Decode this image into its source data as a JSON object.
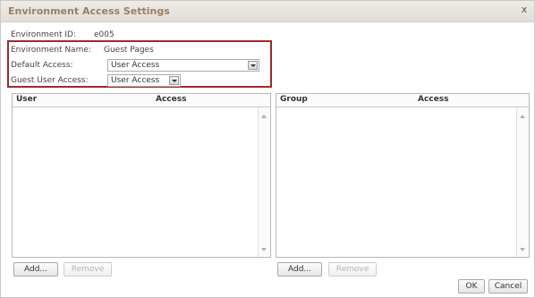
{
  "dialog": {
    "title": "Environment Access Settings",
    "close_label": "x"
  },
  "fields": {
    "environment_id_label": "Environment ID:",
    "environment_id_value": "e005",
    "environment_name_label": "Environment Name:",
    "environment_name_value": "Guest Pages",
    "default_access_label": "Default Access:",
    "default_access_value": "User Access",
    "guest_user_access_label": "Guest User Access:",
    "guest_user_access_value": "User Access"
  },
  "user_panel": {
    "col_user": "User",
    "col_access": "Access",
    "add_label": "Add...",
    "remove_label": "Remove"
  },
  "group_panel": {
    "col_group": "Group",
    "col_access": "Access",
    "add_label": "Add...",
    "remove_label": "Remove"
  },
  "footer": {
    "ok_label": "OK",
    "cancel_label": "Cancel"
  }
}
